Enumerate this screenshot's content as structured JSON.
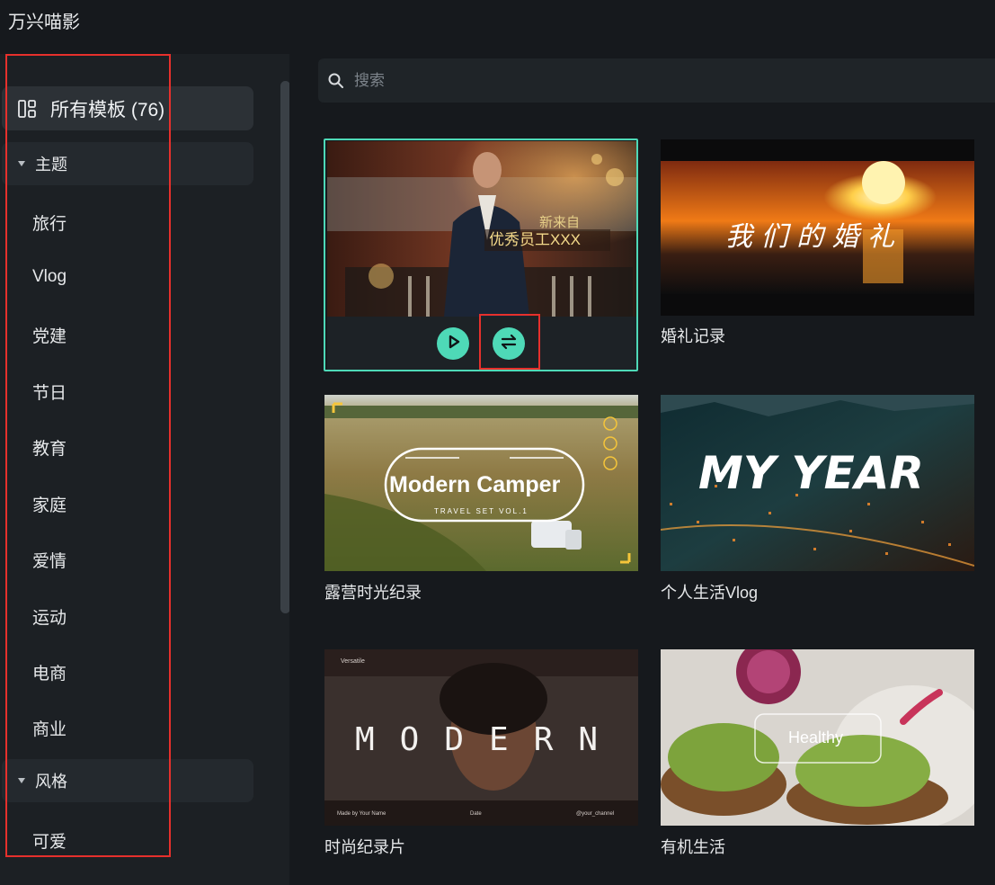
{
  "app": {
    "title": "万兴喵影"
  },
  "sidebar": {
    "all_templates": "所有模板 (76)",
    "groups": [
      {
        "label": "主题"
      },
      {
        "label": "风格"
      }
    ],
    "theme_items": [
      {
        "label": "旅行"
      },
      {
        "label": "Vlog"
      },
      {
        "label": "党建"
      },
      {
        "label": "节日"
      },
      {
        "label": "教育"
      },
      {
        "label": "家庭"
      },
      {
        "label": "爱情"
      },
      {
        "label": "运动"
      },
      {
        "label": "电商"
      },
      {
        "label": "商业"
      }
    ],
    "style_items": [
      {
        "label": "可爱"
      }
    ]
  },
  "search": {
    "placeholder": "搜索"
  },
  "templates": [
    {
      "title": "",
      "overlay_text": "优秀员工XXX",
      "overlay_small": "新来自",
      "selected": true
    },
    {
      "title": "婚礼记录",
      "overlay_text": "我 们 的 婚 礼"
    },
    {
      "title": "露营时光纪录",
      "overlay_text": "Modern Camper",
      "overlay_small": "TRAVEL SET VOL.1"
    },
    {
      "title": "个人生活Vlog",
      "overlay_text": "MY YEAR"
    },
    {
      "title": "时尚纪录片",
      "overlay_text": "MODERN",
      "overlay_small": "Versatile",
      "footer_left": "Made by Your Name",
      "footer_mid": "Date",
      "footer_right": "@your_channel"
    },
    {
      "title": "有机生活",
      "overlay_text": "Healthy"
    }
  ],
  "colors": {
    "accent": "#4ed9b7",
    "annotation": "#e6302c",
    "sidebar_bg": "#1c2024",
    "bg": "#16191d"
  },
  "icons": {
    "all_templates": "layout-grid-icon",
    "search": "search-icon",
    "play": "play-icon",
    "replace": "swap-arrows-icon"
  }
}
